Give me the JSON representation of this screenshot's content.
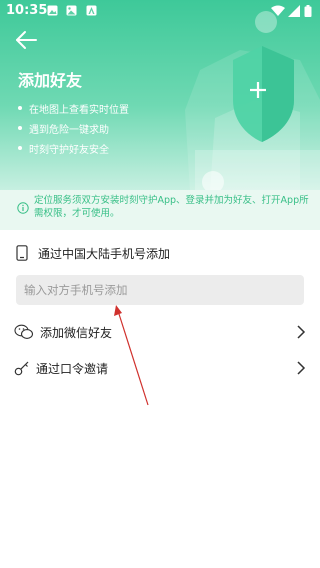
{
  "status_bar": {
    "time": "10:35",
    "left_icons": [
      "gallery-icon",
      "image-icon",
      "a-icon"
    ],
    "right_icons": [
      "wifi-icon",
      "signal-icon",
      "battery-icon"
    ]
  },
  "header": {
    "title": "添加好友",
    "bullets": [
      "在地图上查看实时位置",
      "遇到危险一键求助",
      "时刻守护好友安全"
    ]
  },
  "notice": {
    "text": "定位服务须双方安装时刻守护App、登录并加为好友、打开App所需权限，才可使用。"
  },
  "phone_section": {
    "label": "通过中国大陆手机号添加",
    "input_placeholder": "输入对方手机号添加",
    "input_value": ""
  },
  "options": [
    {
      "label": "添加微信好友",
      "icon": "wechat-icon"
    },
    {
      "label": "通过口令邀请",
      "icon": "key-icon"
    }
  ],
  "colors": {
    "accent": "#3ec999",
    "notice_bg": "#e9f8f1",
    "notice_text": "#38bf87",
    "annotation": "#d0312d"
  }
}
